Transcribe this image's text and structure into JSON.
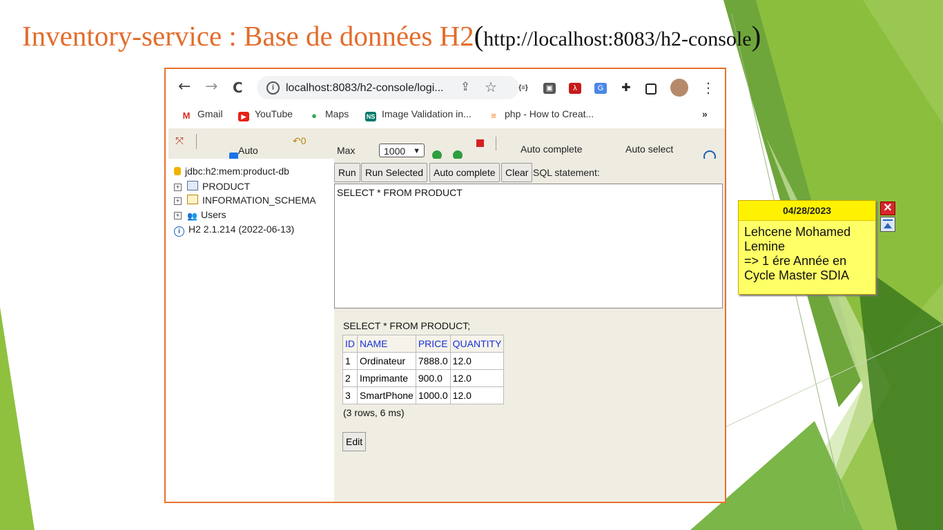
{
  "slide": {
    "title_main": "Inventory-service : Base de données H2",
    "title_open_paren": "(",
    "title_url": "http://localhost:8083/h2-console",
    "title_close_paren": ")"
  },
  "browser": {
    "back_icon": "←",
    "forward_icon": "→",
    "reload_icon": "C",
    "url": "localhost:8083/h2-console/logi...",
    "menu_icon": "⋮",
    "bookmarks": [
      {
        "label": "Gmail",
        "icon": "gmail-icon",
        "color": "#d93025",
        "glyph": "M"
      },
      {
        "label": "YouTube",
        "icon": "youtube-icon",
        "color": "#e62117",
        "glyph": "▶"
      },
      {
        "label": "Maps",
        "icon": "maps-icon",
        "color": "#34a853",
        "glyph": "●"
      },
      {
        "label": "Image Validation in...",
        "icon": "ns-icon",
        "color": "#00796b",
        "glyph": "NS"
      },
      {
        "label": "php - How to Creat...",
        "icon": "stackoverflow-icon",
        "color": "#f48024",
        "glyph": "≡"
      }
    ],
    "bookmarks_more": "»"
  },
  "h2_toolbar": {
    "auto_label": "Auto",
    "max_label": "Max",
    "max_rows_value": "1000",
    "auto_complete_label": "Auto complete",
    "auto_select_label": "Auto select"
  },
  "tree": {
    "connection": "jdbc:h2:mem:product-db",
    "items": [
      "PRODUCT",
      "INFORMATION_SCHEMA",
      "Users"
    ],
    "version": "H2 2.1.214 (2022-06-13)"
  },
  "query_bar": {
    "run": "Run",
    "run_selected": "Run Selected",
    "auto_complete": "Auto complete",
    "clear": "Clear",
    "sql_statement_label": "SQL statement:"
  },
  "editor": {
    "sql": "SELECT * FROM PRODUCT"
  },
  "result": {
    "statement": "SELECT * FROM PRODUCT;",
    "columns": [
      "ID",
      "NAME",
      "PRICE",
      "QUANTITY"
    ],
    "rows": [
      [
        "1",
        "Ordinateur",
        "7888.0",
        "12.0"
      ],
      [
        "2",
        "Imprimante",
        "900.0",
        "12.0"
      ],
      [
        "3",
        "SmartPhone",
        "1000.0",
        "12.0"
      ]
    ],
    "summary": "(3 rows, 6 ms)",
    "edit_button": "Edit"
  },
  "note": {
    "date": "04/28/2023",
    "line1": "Lehcene Mohamed",
    "line2": "Lemine",
    "line3": "=> 1 ére Année en",
    "line4": "Cycle Master SDIA",
    "close_glyph": "✕"
  },
  "colors": {
    "title_orange": "#e36c2b",
    "frame_orange": "#e8702a",
    "green_dark": "#4e8f2a",
    "green_mid": "#7ab648",
    "green_light": "#a6d05c",
    "h2_panel": "#eeebe1",
    "note_yellow": "#ffff66",
    "header_blue": "#1a2fd8"
  }
}
